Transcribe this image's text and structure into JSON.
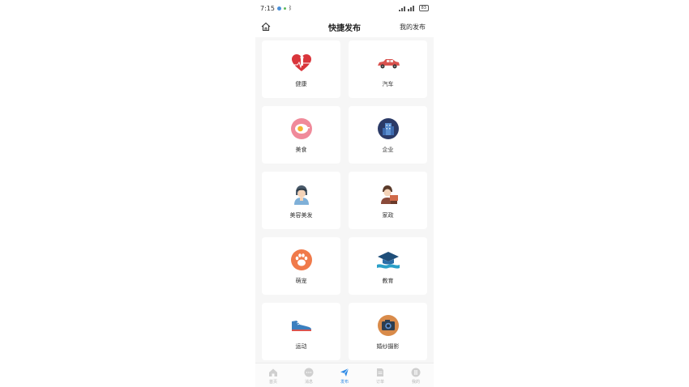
{
  "status_bar": {
    "time": "7:15",
    "battery": "83"
  },
  "header": {
    "title": "快捷发布",
    "right_link": "我的发布"
  },
  "categories": [
    {
      "label": "健康",
      "icon": "heart-health-icon",
      "color": "#d9353b"
    },
    {
      "label": "汽车",
      "icon": "car-icon",
      "color": "#d9534f"
    },
    {
      "label": "美食",
      "icon": "egg-food-icon",
      "color": "#f08a9a"
    },
    {
      "label": "企业",
      "icon": "building-icon",
      "color": "#2b3a67"
    },
    {
      "label": "美容美发",
      "icon": "hairdresser-icon",
      "color": "#4a5a6a"
    },
    {
      "label": "家政",
      "icon": "housekeeper-icon",
      "color": "#8a4a3a"
    },
    {
      "label": "萌宠",
      "icon": "paw-icon",
      "color": "#f07a4a"
    },
    {
      "label": "教育",
      "icon": "graduation-cap-icon",
      "color": "#2aa0c8"
    },
    {
      "label": "运动",
      "icon": "sneaker-icon",
      "color": "#3b7fbf"
    },
    {
      "label": "婚纱摄影",
      "icon": "camera-icon",
      "color": "#d98b4a"
    }
  ],
  "tabs": [
    {
      "label": "首页",
      "icon": "home-icon",
      "active": false
    },
    {
      "label": "消息",
      "icon": "chat-icon",
      "active": false
    },
    {
      "label": "发布",
      "icon": "send-icon",
      "active": true
    },
    {
      "label": "订单",
      "icon": "document-icon",
      "active": false
    },
    {
      "label": "我的",
      "icon": "user-icon",
      "active": false
    }
  ],
  "colors": {
    "accent": "#2e8ae6",
    "tab_inactive": "#c8c8c8",
    "background": "#f6f6f6"
  }
}
